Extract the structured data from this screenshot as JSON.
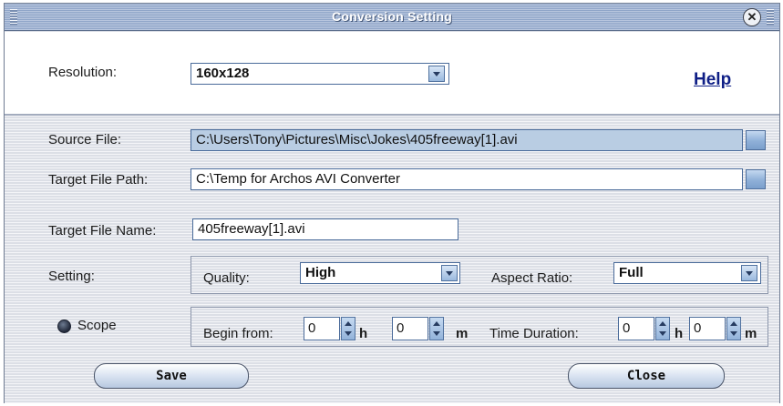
{
  "window": {
    "title": "Conversion Setting"
  },
  "resolution": {
    "label": "Resolution:",
    "value": "160x128"
  },
  "help": {
    "label": "Help"
  },
  "source_file": {
    "label": "Source File:",
    "value": "C:\\Users\\Tony\\Pictures\\Misc\\Jokes\\405freeway[1].avi"
  },
  "target_path": {
    "label": "Target File Path:",
    "value": "C:\\Temp for Archos AVI Converter"
  },
  "target_name": {
    "label": "Target File Name:",
    "value": "405freeway[1].avi"
  },
  "setting": {
    "label": "Setting:",
    "quality_label": "Quality:",
    "quality_value": "High",
    "aspect_label": "Aspect Ratio:",
    "aspect_value": "Full"
  },
  "scope": {
    "label": "Scope",
    "begin_label": "Begin from:",
    "begin_h_value": "0",
    "h_unit": "h",
    "begin_m_value": "0",
    "m_unit": "m",
    "duration_label": "Time Duration:",
    "duration_h_value": "0",
    "duration_m_value": "0"
  },
  "buttons": {
    "save": "Save",
    "close": "Close"
  }
}
